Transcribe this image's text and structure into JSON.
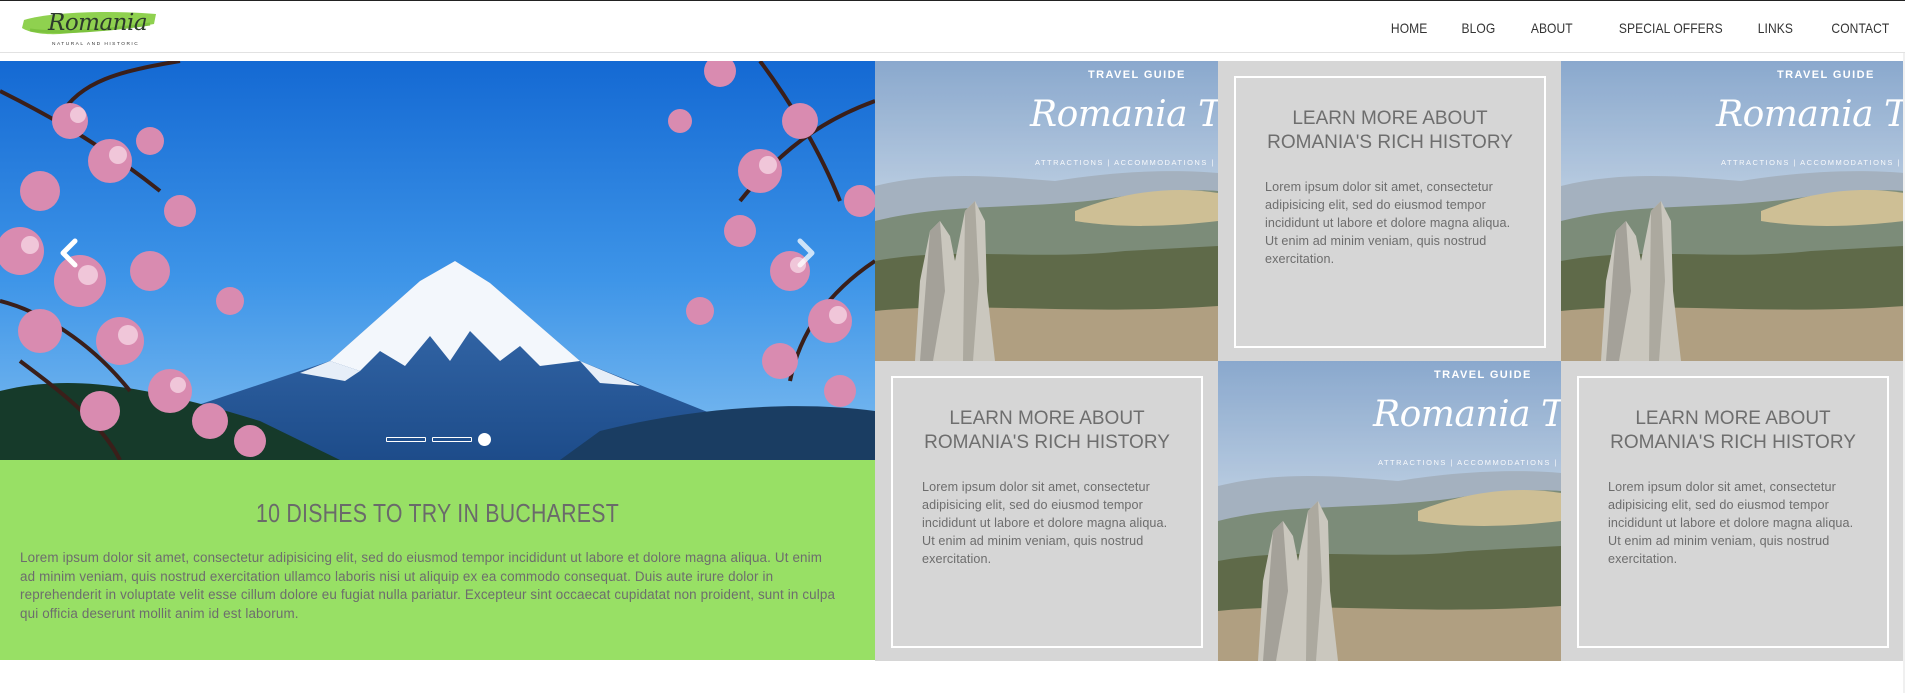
{
  "header": {
    "logo_text": "Romania",
    "logo_tagline": "Natural and Historic",
    "nav": [
      "HOME",
      "BLOG",
      "ABOUT",
      "SPECIAL OFFERS",
      "LINKS",
      "CONTACT"
    ]
  },
  "slider": {
    "prev_icon": "chevron-left-icon",
    "next_icon": "chevron-right-icon",
    "slide_count": 3,
    "active_slide": 3
  },
  "feature": {
    "title": "10 DISHES TO TRY IN BUCHAREST",
    "body": "Lorem ipsum dolor sit amet, consectetur adipisicing elit, sed do eiusmod tempor incididunt ut labore et dolore magna aliqua. Ut enim ad minim veniam, quis nostrud exercitation ullamco laboris nisi ut aliquip ex ea commodo consequat. Duis aute irure dolor in reprehenderit in voluptate velit esse cillum dolore eu fugiat nulla pariatur. Excepteur sint occaecat cupidatat non proident, sunt in culpa qui officia deserunt mollit anim id est laborum."
  },
  "guide": {
    "small": "TRAVEL GUIDE",
    "big": "Romania Travel",
    "sub": "ATTRACTIONS | ACCOMMODATIONS | DINING"
  },
  "cards": [
    {
      "title": "LEARN MORE ABOUT ROMANIA'S RICH HISTORY",
      "body": "Lorem ipsum dolor sit amet, consectetur adipisicing elit, sed do eiusmod tempor incididunt ut labore et dolore magna aliqua. Ut enim ad minim veniam, quis nostrud exercitation."
    },
    {
      "title": "LEARN MORE ABOUT ROMANIA'S RICH HISTORY",
      "body": "Lorem ipsum dolor sit amet, consectetur adipisicing elit, sed do eiusmod tempor incididunt ut labore et dolore magna aliqua. Ut enim ad minim veniam, quis nostrud exercitation."
    },
    {
      "title": "LEARN MORE ABOUT ROMANIA'S RICH HISTORY",
      "body": "Lorem ipsum dolor sit amet, consectetur adipisicing elit, sed do eiusmod tempor incididunt ut labore et dolore magna aliqua. Ut enim ad minim veniam, quis nostrud exercitation."
    }
  ],
  "colors": {
    "accent_green": "#98e065",
    "card_gray": "#d6d6d6",
    "text_gray": "#6d6d6d"
  }
}
